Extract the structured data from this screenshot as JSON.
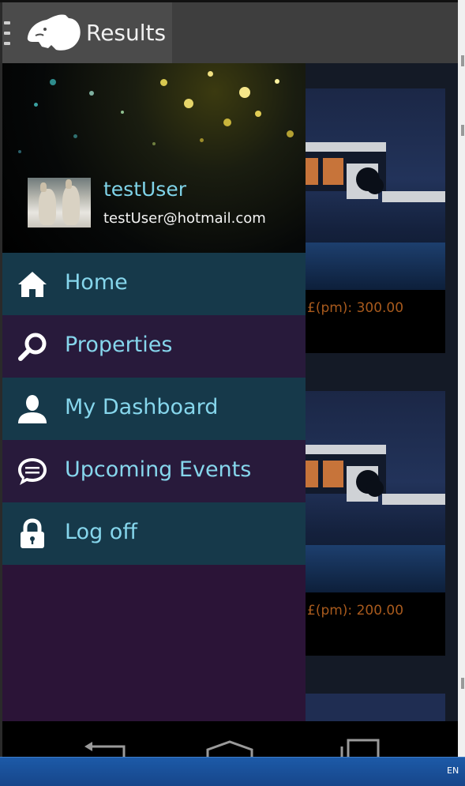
{
  "actionbar": {
    "title": "Results"
  },
  "drawer": {
    "user": {
      "name": "testUser",
      "email": "testUser@hotmail.com"
    },
    "items": [
      {
        "label": "Home",
        "icon": "home-icon"
      },
      {
        "label": "Properties",
        "icon": "search-icon"
      },
      {
        "label": "My Dashboard",
        "icon": "user-icon"
      },
      {
        "label": "Upcoming Events",
        "icon": "chat-bubble-icon"
      },
      {
        "label": "Log off",
        "icon": "lock-icon"
      }
    ]
  },
  "listings": [
    {
      "price": "£(pm): 300.00"
    },
    {
      "price": "£(pm): 200.00"
    }
  ],
  "taskbar": {
    "language": "EN"
  },
  "colors": {
    "accent": "#86d6ec",
    "price": "#a85a1d",
    "drawer_bg": "#2b1437",
    "item_teal": "#16394a",
    "item_purple": "#281a3b"
  }
}
